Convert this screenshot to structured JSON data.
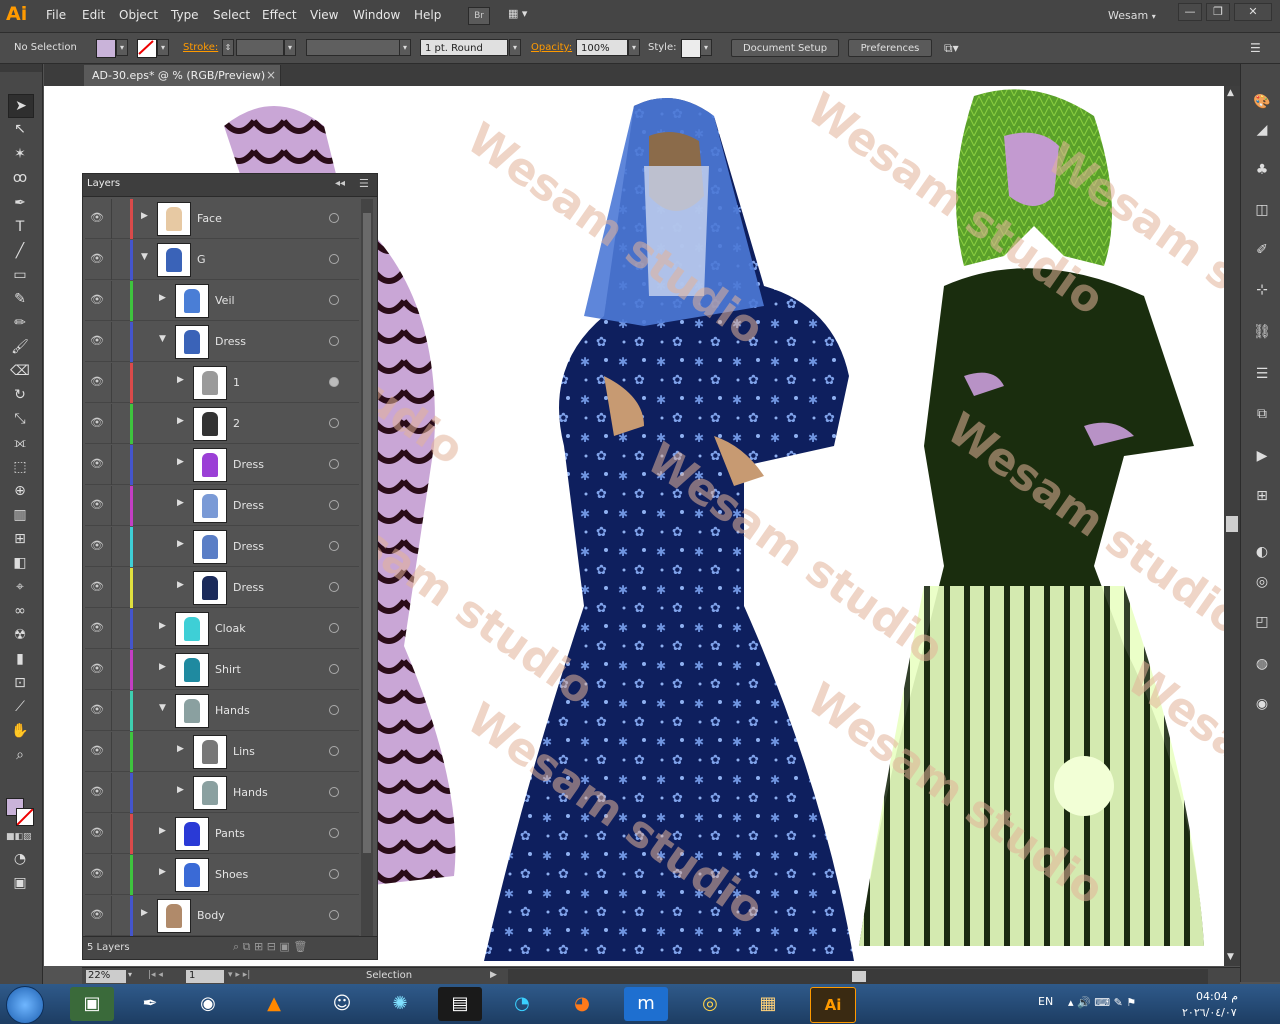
{
  "app": {
    "logo": "Ai",
    "user": "Wesam",
    "user_caret": "▾"
  },
  "menu": [
    "File",
    "Edit",
    "Object",
    "Type",
    "Select",
    "Effect",
    "View",
    "Window",
    "Help"
  ],
  "menu_extras": {
    "bridge": "Br",
    "arrange": "▦ ▾"
  },
  "window_controls": {
    "minimize": "—",
    "restore": "❐",
    "close": "✕"
  },
  "control_bar": {
    "selection": "No Selection",
    "stroke_label": "Stroke:",
    "stroke_weight": "",
    "stroke_profile": "1 pt. Round",
    "opacity_label": "Opacity:",
    "opacity_value": "100%",
    "style_label": "Style:",
    "document_setup": "Document Setup",
    "preferences": "Preferences"
  },
  "document_tab": {
    "title": "AD-30.eps* @ % (RGB/Preview)",
    "close": "×"
  },
  "watermark": "Wesam studio",
  "layers_panel": {
    "title": "Layers",
    "footer_count": "5 Layers",
    "rows": [
      {
        "name": "Face",
        "indent": 0,
        "expanded": false,
        "color": "#d94a4a",
        "thumb": "#e7c9a3"
      },
      {
        "name": "G",
        "indent": 0,
        "expanded": true,
        "color": "#4455cc",
        "thumb": "#3a63b8"
      },
      {
        "name": "Veil",
        "indent": 1,
        "expanded": false,
        "color": "#3ec43e",
        "thumb": "#4a7ed6"
      },
      {
        "name": "Dress",
        "indent": 1,
        "expanded": true,
        "color": "#4455cc",
        "thumb": "#3a63b8"
      },
      {
        "name": "1",
        "indent": 2,
        "expanded": false,
        "color": "#d94a4a",
        "thumb": "#9a9a9a"
      },
      {
        "name": "2",
        "indent": 2,
        "expanded": false,
        "color": "#3ec43e",
        "thumb": "#333333"
      },
      {
        "name": "Dress",
        "indent": 2,
        "expanded": false,
        "color": "#4455cc",
        "thumb": "#9b3fd6"
      },
      {
        "name": "Dress",
        "indent": 2,
        "expanded": false,
        "color": "#c43ec4",
        "thumb": "#7a9ad6"
      },
      {
        "name": "Dress",
        "indent": 2,
        "expanded": false,
        "color": "#3ecfd6",
        "thumb": "#5a7ec6"
      },
      {
        "name": "Dress",
        "indent": 2,
        "expanded": false,
        "color": "#e0e03e",
        "thumb": "#1a2a5a"
      },
      {
        "name": "Cloak",
        "indent": 1,
        "expanded": false,
        "color": "#4455cc",
        "thumb": "#3ecfd6"
      },
      {
        "name": "Shirt",
        "indent": 1,
        "expanded": false,
        "color": "#c43ec4",
        "thumb": "#1f8aa0"
      },
      {
        "name": "Hands",
        "indent": 1,
        "expanded": true,
        "color": "#3ecfb0",
        "thumb": "#8aa0a0"
      },
      {
        "name": "Lins",
        "indent": 2,
        "expanded": false,
        "color": "#3ec43e",
        "thumb": "#777777"
      },
      {
        "name": "Hands",
        "indent": 2,
        "expanded": false,
        "color": "#4455cc",
        "thumb": "#8aa0a0"
      },
      {
        "name": "Pants",
        "indent": 1,
        "expanded": false,
        "color": "#d94a4a",
        "thumb": "#2a3ad6"
      },
      {
        "name": "Shoes",
        "indent": 1,
        "expanded": false,
        "color": "#3ec43e",
        "thumb": "#3a6ad6"
      },
      {
        "name": "Body",
        "indent": 0,
        "expanded": false,
        "color": "#4455cc",
        "thumb": "#b08a6a"
      }
    ]
  },
  "status_bar": {
    "zoom": "22%",
    "artboard": "1",
    "tool": "Selection"
  },
  "taskbar": {
    "lang": "EN",
    "time": "04:04 م",
    "date": "٢٠٢٦/٠٤/٠٧"
  },
  "colors": {
    "fill_swatch": "#c9b3d9",
    "accent": "#ff9a00"
  }
}
